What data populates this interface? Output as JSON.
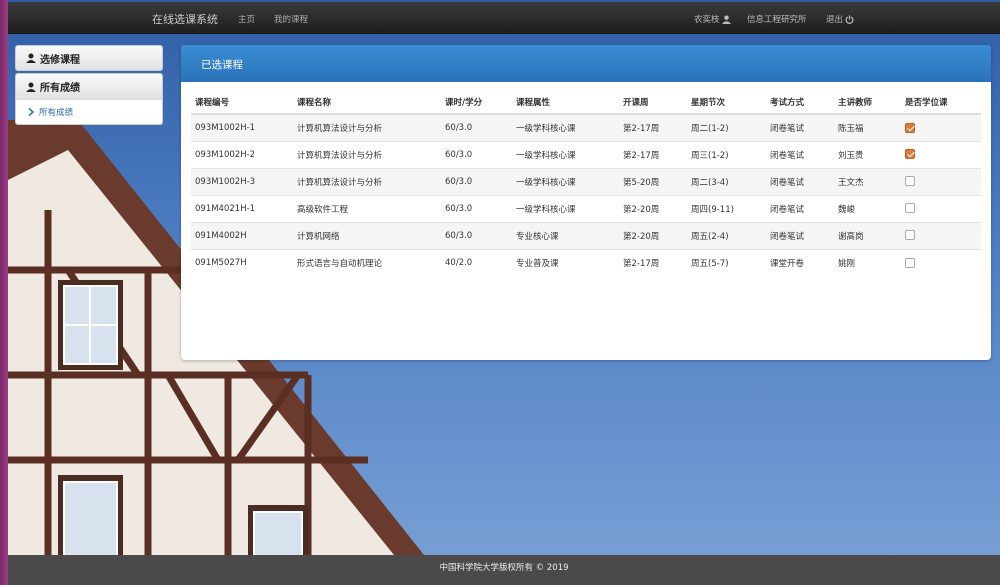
{
  "navbar": {
    "brand": "在线选课系统",
    "links": [
      "主页",
      "我的课程"
    ],
    "user": "农奕枝",
    "dept": "信息工程研究所",
    "logout": "退出"
  },
  "sidebar": {
    "items": [
      {
        "label": "选修课程"
      },
      {
        "label": "所有成绩"
      }
    ],
    "sub_item": "所有成绩"
  },
  "panel": {
    "title": "已选课程",
    "columns": [
      "课程编号",
      "课程名称",
      "课时/学分",
      "课程属性",
      "开课周",
      "星期节次",
      "考试方式",
      "主讲教师",
      "是否学位课"
    ],
    "rows": [
      {
        "code": "093M1002H-1",
        "name": "计算机算法设计与分析",
        "hours": "60/3.0",
        "attr": "一级学科核心课",
        "weeks": "第2-17周",
        "time": "周二(1-2)",
        "exam": "闭卷笔试",
        "teacher": "陈玉福",
        "degree": true
      },
      {
        "code": "093M1002H-2",
        "name": "计算机算法设计与分析",
        "hours": "60/3.0",
        "attr": "一级学科核心课",
        "weeks": "第2-17周",
        "time": "周三(1-2)",
        "exam": "闭卷笔试",
        "teacher": "刘玉贵",
        "degree": true
      },
      {
        "code": "093M1002H-3",
        "name": "计算机算法设计与分析",
        "hours": "60/3.0",
        "attr": "一级学科核心课",
        "weeks": "第5-20周",
        "time": "周二(3-4)",
        "exam": "闭卷笔试",
        "teacher": "王文杰",
        "degree": false
      },
      {
        "code": "091M4021H-1",
        "name": "高级软件工程",
        "hours": "60/3.0",
        "attr": "一级学科核心课",
        "weeks": "第2-20周",
        "time": "周四(9-11)",
        "exam": "闭卷笔试",
        "teacher": "魏峻",
        "degree": false
      },
      {
        "code": "091M4002H",
        "name": "计算机网络",
        "hours": "60/3.0",
        "attr": "专业核心课",
        "weeks": "第2-20周",
        "time": "周五(2-4)",
        "exam": "闭卷笔试",
        "teacher": "谢高岗",
        "degree": false
      },
      {
        "code": "091M5027H",
        "name": "形式语言与自动机理论",
        "hours": "40/2.0",
        "attr": "专业普及课",
        "weeks": "第2-17周",
        "time": "周五(5-7)",
        "exam": "课堂开卷",
        "teacher": "姚刚",
        "degree": false
      }
    ]
  },
  "footer": {
    "text": "中国科学院大学版权所有 © 2019"
  },
  "colors": {
    "accent": "#2a72b8",
    "checkbox_on": "#e07a3c"
  }
}
